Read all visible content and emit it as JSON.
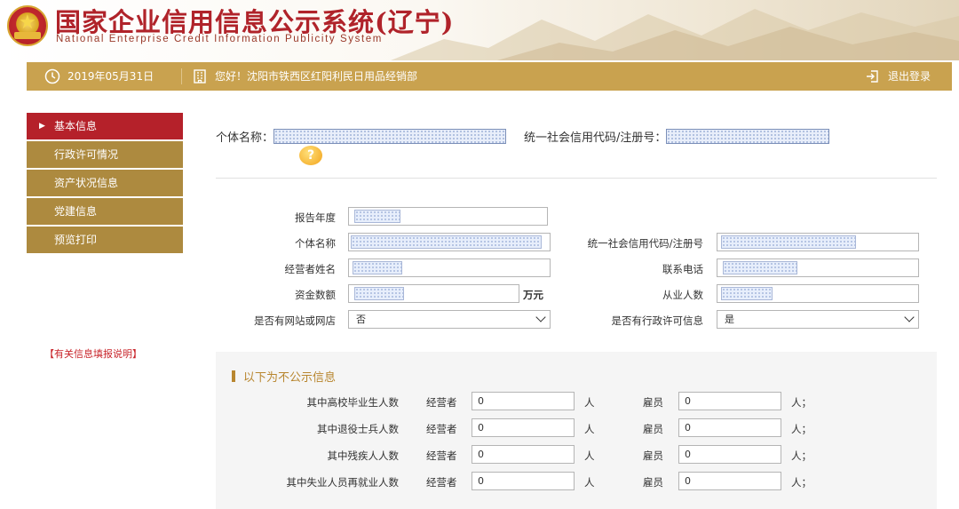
{
  "header": {
    "title": "国家企业信用信息公示系统(辽宁)",
    "subtitle": "National Enterprise Credit Information Publicity System"
  },
  "topbar": {
    "date": "2019年05月31日",
    "greeting": "您好！沈阳市铁西区红阳利民日用品经销部",
    "logout": "退出登录"
  },
  "sidebar": {
    "items": [
      {
        "label": "基本信息",
        "active": true
      },
      {
        "label": "行政许可情况"
      },
      {
        "label": "资产状况信息"
      },
      {
        "label": "党建信息"
      },
      {
        "label": "预览打印"
      }
    ],
    "note": "【有关信息填报说明】"
  },
  "top_fields": {
    "name_label": "个体名称：",
    "code_label": "统一社会信用代码/注册号："
  },
  "form": {
    "report_year_label": "报告年度",
    "name_label": "个体名称",
    "code_label": "统一社会信用代码/注册号",
    "operator_label": "经营者姓名",
    "phone_label": "联系电话",
    "capital_label": "资金数额",
    "capital_unit": "万元",
    "employees_label": "从业人数",
    "website_label": "是否有网站或网店",
    "website_value": "否",
    "permit_label": "是否有行政许可信息",
    "permit_value": "是"
  },
  "nonpublic": {
    "title": "以下为不公示信息",
    "operator_label": "经营者",
    "employee_label": "雇员",
    "unit": "人",
    "unit_end": "人；",
    "rows": [
      {
        "label": "其中高校毕业生人数",
        "operator": "0",
        "employee": "0"
      },
      {
        "label": "其中退役士兵人数",
        "operator": "0",
        "employee": "0"
      },
      {
        "label": "其中残疾人人数",
        "operator": "0",
        "employee": "0"
      },
      {
        "label": "其中失业人员再就业人数",
        "operator": "0",
        "employee": "0"
      }
    ]
  }
}
